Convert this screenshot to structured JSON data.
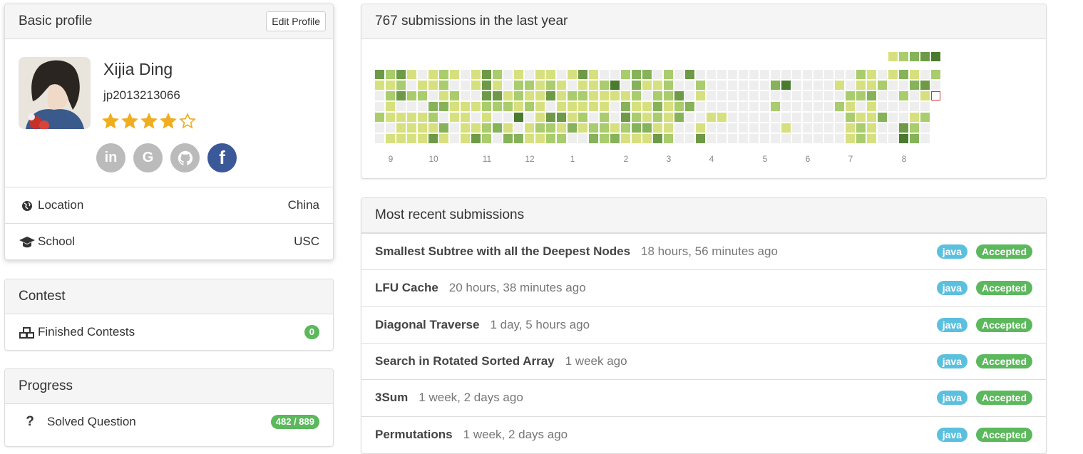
{
  "profile": {
    "header": "Basic profile",
    "edit_label": "Edit Profile",
    "name": "Xijia Ding",
    "handle": "jp2013213066",
    "rating_stars": 4,
    "rating_max": 5,
    "star_color": "#f0ad1e",
    "socials": [
      {
        "name": "linkedin-icon",
        "glyph": "in"
      },
      {
        "name": "google-icon",
        "glyph": "G"
      },
      {
        "name": "github-icon",
        "glyph": "gh"
      },
      {
        "name": "facebook-icon",
        "glyph": "f"
      }
    ],
    "location_label": "Location",
    "location_value": "China",
    "school_label": "School",
    "school_value": "USC"
  },
  "contest": {
    "header": "Contest",
    "finished_label": "Finished Contests",
    "finished_count": "0"
  },
  "progress": {
    "header": "Progress",
    "solved_label": "Solved Question",
    "solved_value": "482 / 889"
  },
  "calendar": {
    "header": "767 submissions in the last year",
    "month_labels": [
      "9",
      "10",
      "11",
      "12",
      "1",
      "2",
      "3",
      "4",
      "5",
      "6",
      "7",
      "8"
    ],
    "legend_colors": [
      "#d7e07f",
      "#a9cc6d",
      "#86b25a",
      "#6e9a48",
      "#4a7a2e"
    ],
    "empty_color": "#eeeeee",
    "today_outline": "#cc3333"
  },
  "recent": {
    "header": "Most recent submissions",
    "items": [
      {
        "title": "Smallest Subtree with all the Deepest Nodes",
        "time": "18 hours, 56 minutes ago",
        "lang": "java",
        "status": "Accepted"
      },
      {
        "title": "LFU Cache",
        "time": "20 hours, 38 minutes ago",
        "lang": "java",
        "status": "Accepted"
      },
      {
        "title": "Diagonal Traverse",
        "time": "1 day, 5 hours ago",
        "lang": "java",
        "status": "Accepted"
      },
      {
        "title": "Search in Rotated Sorted Array",
        "time": "1 week ago",
        "lang": "java",
        "status": "Accepted"
      },
      {
        "title": "3Sum",
        "time": "1 week, 2 days ago",
        "lang": "java",
        "status": "Accepted"
      },
      {
        "title": "Permutations",
        "time": "1 week, 2 days ago",
        "lang": "java",
        "status": "Accepted"
      }
    ]
  }
}
